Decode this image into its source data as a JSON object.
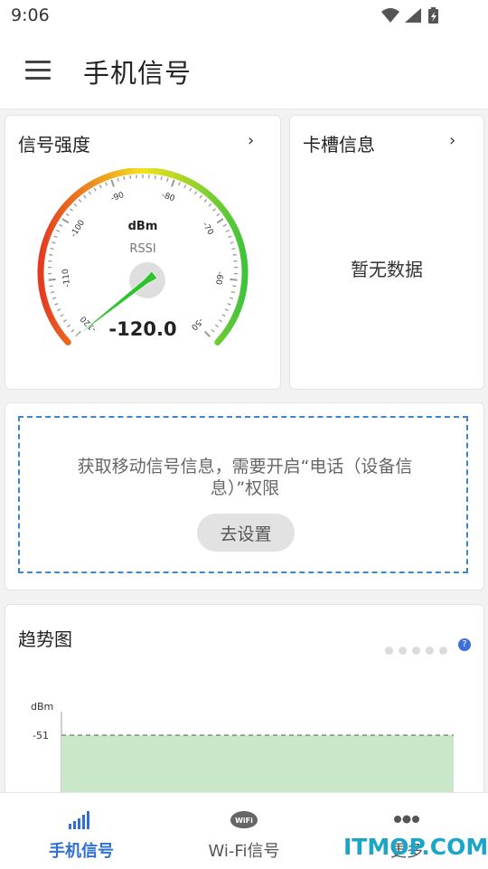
{
  "status_bar": {
    "time": "9:06"
  },
  "app_bar": {
    "title": "手机信号",
    "menu_icon": "hamburger-menu-icon"
  },
  "signal_card": {
    "title": "信号强度",
    "unit": "dBm",
    "metric": "RSSI",
    "value": "-120.0",
    "gauge_range": [
      -120,
      -50
    ],
    "gauge_value": -120.0,
    "ticks": [
      "-120",
      "-110",
      "-100",
      "-90",
      "-80",
      "-70",
      "-60",
      "-50"
    ]
  },
  "sim_card": {
    "title": "卡槽信息",
    "empty_text": "暂无数据"
  },
  "permission": {
    "message": "获取移动信号信息，需要开启“电话（设备信息）”权限",
    "button_label": "去设置"
  },
  "trend": {
    "title": "趋势图",
    "help_label": "?",
    "page_dots": 5,
    "chart_data": {
      "type": "area",
      "ylabel": "dBm",
      "y_ticks": [
        "-51"
      ],
      "series": [
        {
          "values": [
            -51,
            -51
          ]
        }
      ]
    }
  },
  "bottom_nav": {
    "tabs": [
      {
        "label": "手机信号",
        "icon": "signal-bars-icon",
        "active": true
      },
      {
        "label": "Wi-Fi信号",
        "icon": "wifi-badge-icon",
        "active": false
      },
      {
        "label": "更多",
        "icon": "more-dots-icon",
        "active": false
      }
    ]
  },
  "watermark": "ITMOP.COM",
  "colors": {
    "accent": "#2f6fd6",
    "gauge_start": "#e53a21",
    "gauge_mid": "#f3e21c",
    "gauge_end": "#3ec43a",
    "needle": "#2ec22e",
    "chart_fill": "#c9e8c9",
    "dash_border": "#3f85c9"
  }
}
